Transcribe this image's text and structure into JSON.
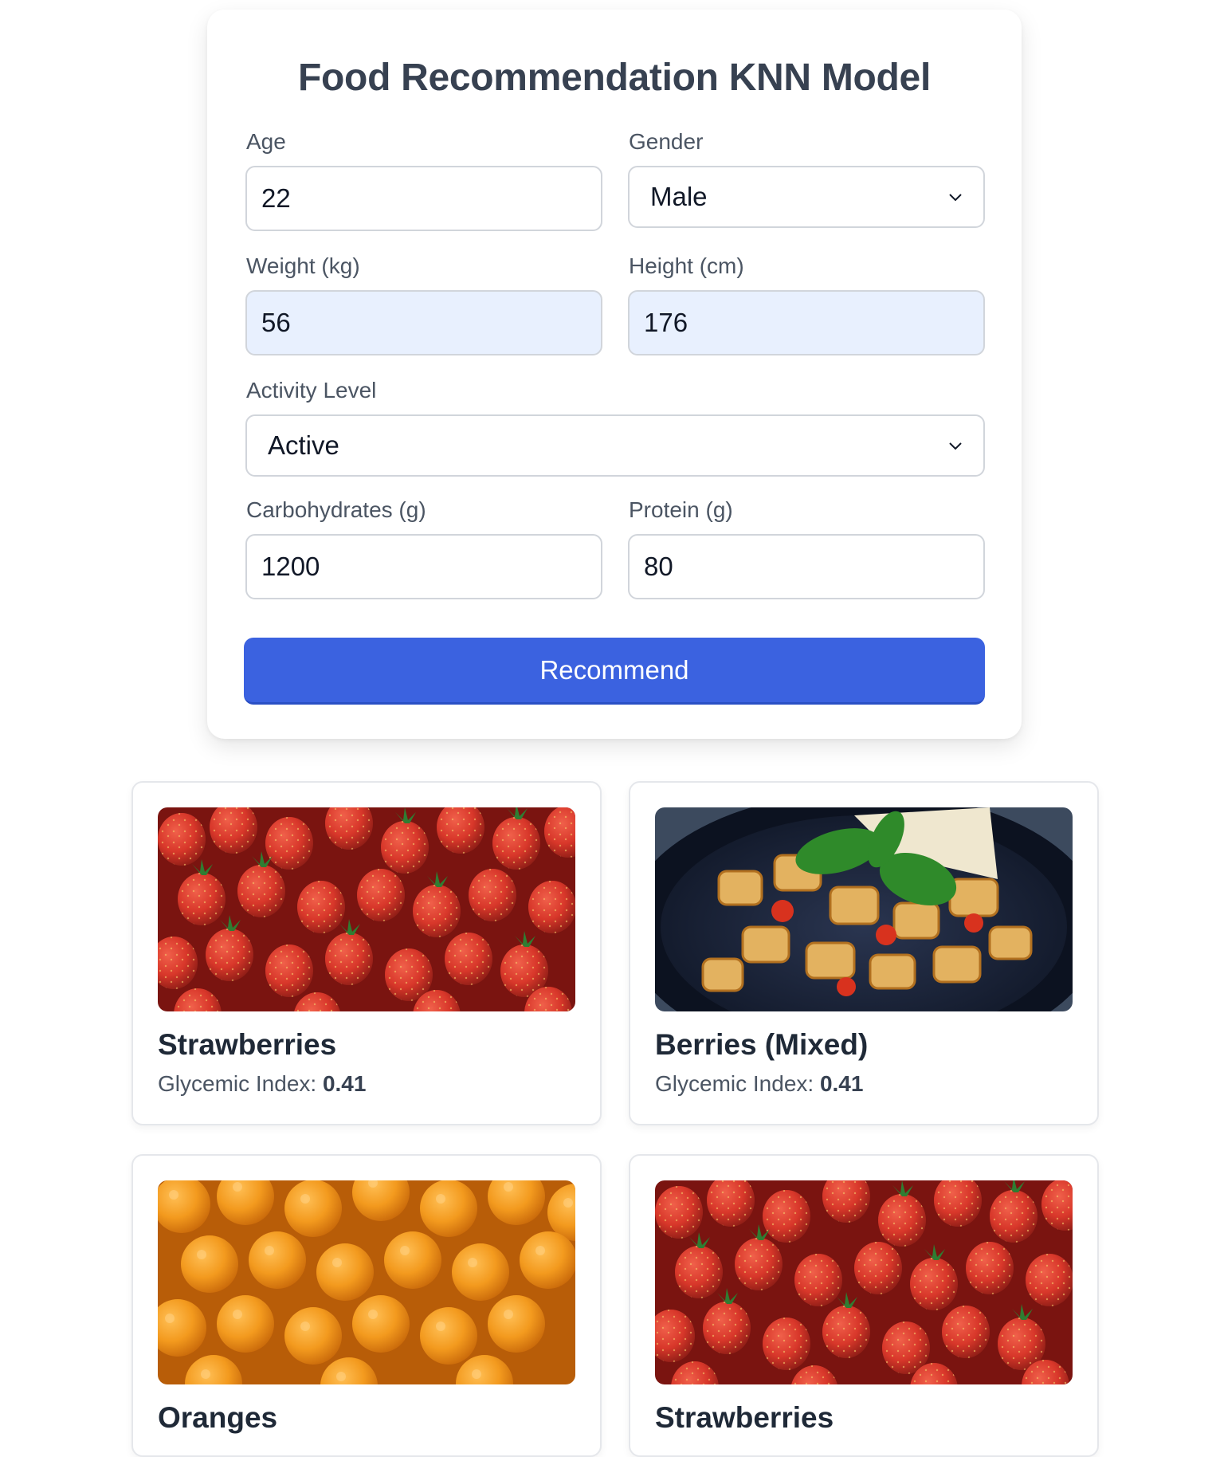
{
  "form": {
    "title": "Food Recommendation KNN Model",
    "age": {
      "label": "Age",
      "value": "22"
    },
    "gender": {
      "label": "Gender",
      "value": "Male"
    },
    "weight": {
      "label": "Weight (kg)",
      "value": "56"
    },
    "height": {
      "label": "Height (cm)",
      "value": "176"
    },
    "activity": {
      "label": "Activity Level",
      "value": "Active"
    },
    "carbs": {
      "label": "Carbohydrates (g)",
      "value": "1200"
    },
    "protein": {
      "label": "Protein (g)",
      "value": "80"
    },
    "submit_label": "Recommend"
  },
  "colors": {
    "accent": "#3b62e0",
    "autofill_bg": "#e8f0fe",
    "title_text": "#374151"
  },
  "results": [
    {
      "name": "Strawberries",
      "gi_label": "Glycemic Index:",
      "gi_value": "0.41",
      "image": "strawberries-photo"
    },
    {
      "name": "Berries (Mixed)",
      "gi_label": "Glycemic Index:",
      "gi_value": "0.41",
      "image": "chicken-dish-photo"
    },
    {
      "name": "Oranges",
      "image": "oranges-photo"
    },
    {
      "name": "Strawberries",
      "image": "strawberries-photo"
    }
  ]
}
